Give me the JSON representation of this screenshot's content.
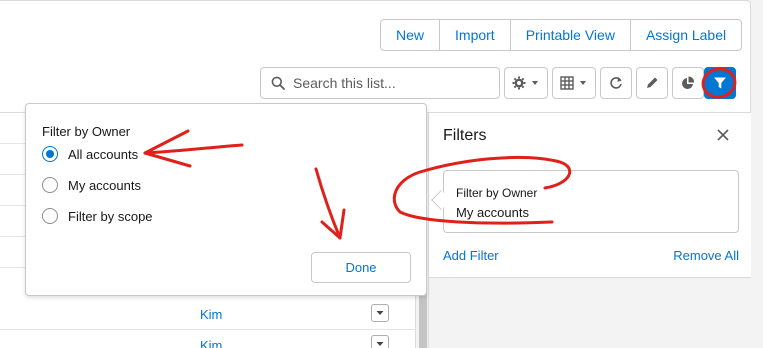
{
  "toolbar": {
    "buttons": [
      "New",
      "Import",
      "Printable View",
      "Assign Label"
    ]
  },
  "search": {
    "placeholder": "Search this list..."
  },
  "icons": {
    "search": "search-icon",
    "settings": "gear-icon",
    "table_view": "table-icon",
    "refresh": "refresh-icon",
    "edit": "pencil-icon",
    "chart": "pie-chart-icon",
    "filter": "filter-icon",
    "close": "close-icon",
    "row_menu": "chevron-down-icon"
  },
  "popover": {
    "title": "Filter by Owner",
    "options": [
      {
        "label": "All accounts",
        "checked": true
      },
      {
        "label": "My accounts",
        "checked": false
      },
      {
        "label": "Filter by scope",
        "checked": false
      }
    ],
    "done_label": "Done"
  },
  "filters": {
    "title": "Filters",
    "card_label": "Filter by Owner",
    "card_value": "My accounts",
    "add_filter": "Add Filter",
    "remove_all": "Remove All"
  },
  "table": {
    "rows": [
      {
        "owner": ""
      },
      {
        "owner": ""
      },
      {
        "owner": ""
      },
      {
        "owner": ""
      },
      {
        "owner": ""
      },
      {
        "owner": "Kim"
      },
      {
        "owner": "Kim"
      }
    ]
  },
  "colors": {
    "accent": "#0176d3",
    "annotation": "#e0201b"
  }
}
